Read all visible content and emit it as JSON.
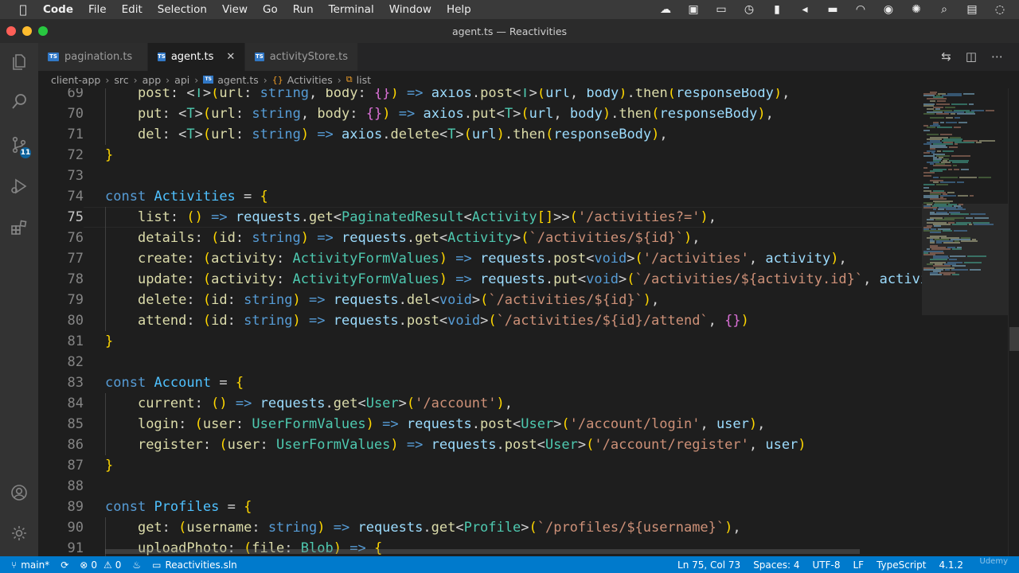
{
  "menubar": {
    "app": "Code",
    "items": [
      "File",
      "Edit",
      "Selection",
      "View",
      "Go",
      "Run",
      "Terminal",
      "Window",
      "Help"
    ]
  },
  "window": {
    "title": "agent.ts — Reactivities"
  },
  "tabs": [
    {
      "label": "pagination.ts",
      "active": false
    },
    {
      "label": "agent.ts",
      "active": true,
      "close": "✕"
    },
    {
      "label": "activityStore.ts",
      "active": false
    }
  ],
  "breadcrumb": [
    "client-app",
    "src",
    "app",
    "api",
    "agent.ts",
    "Activities",
    "list"
  ],
  "activitybar": {
    "scm_badge": "11"
  },
  "editor": {
    "current_line": "75",
    "lines": [
      {
        "n": "69",
        "code": "    post: <T>(url: string, body: {}) => axios.post<T>(url, body).then(responseBody),"
      },
      {
        "n": "70",
        "code": "    put: <T>(url: string, body: {}) => axios.put<T>(url, body).then(responseBody),"
      },
      {
        "n": "71",
        "code": "    del: <T>(url: string) => axios.delete<T>(url).then(responseBody),"
      },
      {
        "n": "72",
        "code": "}"
      },
      {
        "n": "73",
        "code": ""
      },
      {
        "n": "74",
        "code": "const Activities = {"
      },
      {
        "n": "75",
        "code": "    list: () => requests.get<PaginatedResult<Activity[]>>('/activities?='), "
      },
      {
        "n": "76",
        "code": "    details: (id: string) => requests.get<Activity>(`/activities/${id}`),"
      },
      {
        "n": "77",
        "code": "    create: (activity: ActivityFormValues) => requests.post<void>('/activities', activity),"
      },
      {
        "n": "78",
        "code": "    update: (activity: ActivityFormValues) => requests.put<void>(`/activities/${activity.id}`, activity),"
      },
      {
        "n": "79",
        "code": "    delete: (id: string) => requests.del<void>(`/activities/${id}`),"
      },
      {
        "n": "80",
        "code": "    attend: (id: string) => requests.post<void>(`/activities/${id}/attend`, {})"
      },
      {
        "n": "81",
        "code": "}"
      },
      {
        "n": "82",
        "code": ""
      },
      {
        "n": "83",
        "code": "const Account = {"
      },
      {
        "n": "84",
        "code": "    current: () => requests.get<User>('/account'),"
      },
      {
        "n": "85",
        "code": "    login: (user: UserFormValues) => requests.post<User>('/account/login', user),"
      },
      {
        "n": "86",
        "code": "    register: (user: UserFormValues) => requests.post<User>('/account/register', user)"
      },
      {
        "n": "87",
        "code": "}"
      },
      {
        "n": "88",
        "code": ""
      },
      {
        "n": "89",
        "code": "const Profiles = {"
      },
      {
        "n": "90",
        "code": "    get: (username: string) => requests.get<Profile>(`/profiles/${username}`),"
      },
      {
        "n": "91",
        "code": "    uploadPhoto: (file: Blob) => {"
      }
    ]
  },
  "statusbar": {
    "branch": "main*",
    "errors": "0",
    "warnings": "0",
    "solution": "Reactivities.sln",
    "position": "Ln 75, Col 73",
    "spaces": "Spaces: 4",
    "encoding": "UTF-8",
    "eol": "LF",
    "language": "TypeScript",
    "version": "4.1.2"
  },
  "watermark": "Udemy",
  "colors": {
    "statusbar": "#007acc",
    "editor_bg": "#1e1e1e",
    "keyword": "#569cd6",
    "type": "#4ec9b0",
    "string": "#ce9178",
    "function": "#dcdcaa",
    "property": "#9cdcfe"
  }
}
